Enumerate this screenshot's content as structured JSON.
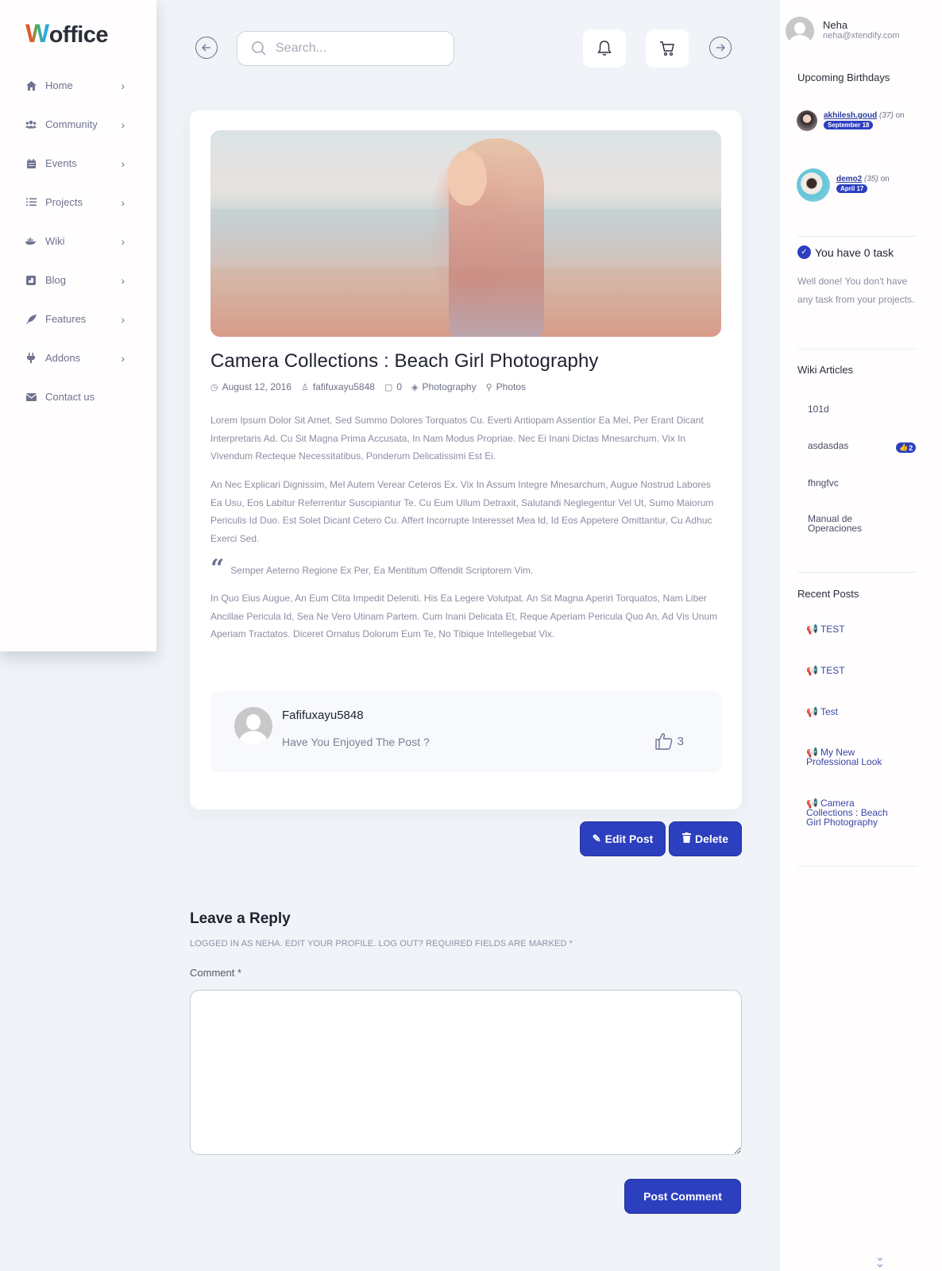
{
  "app": {
    "logo_w": "W",
    "logo_rest": "office"
  },
  "sidebar": {
    "items": [
      {
        "label": "Home",
        "icon": "home-icon",
        "has_submenu": true
      },
      {
        "label": "Community",
        "icon": "users-icon",
        "has_submenu": true
      },
      {
        "label": "Events",
        "icon": "calendar-icon",
        "has_submenu": true
      },
      {
        "label": "Projects",
        "icon": "tasks-icon",
        "has_submenu": true
      },
      {
        "label": "Wiki",
        "icon": "docker-icon",
        "has_submenu": true
      },
      {
        "label": "Blog",
        "icon": "blog-icon",
        "has_submenu": true
      },
      {
        "label": "Features",
        "icon": "feather-icon",
        "has_submenu": true
      },
      {
        "label": "Addons",
        "icon": "plug-icon",
        "has_submenu": true
      },
      {
        "label": "Contact us",
        "icon": "envelope-icon",
        "has_submenu": false
      }
    ],
    "chevron": "›"
  },
  "topbar": {
    "search_placeholder": "Search...",
    "back_icon": "←",
    "forward_icon": "→"
  },
  "post": {
    "title": "Camera Collections : Beach Girl Photography",
    "meta": {
      "date": "August 12, 2016",
      "author": "fafifuxayu5848",
      "comments": "0",
      "category": "Photography",
      "tag": "Photos"
    },
    "paragraphs": [
      "Lorem Ipsum Dolor Sit Amet, Sed Summo Dolores Torquatos Cu. Everti Antiopam Assentior Ea Mei, Per Erant Dicant Interpretaris Ad. Cu Sit Magna Prima Accusata, In Nam Modus Propriae. Nec Ei Inani Dictas Mnesarchum. Vix In Vivendum Recteque Necessitatibus, Ponderum Delicatissimi Est Ei.",
      "An Nec Explicari Dignissim, Mel Autem Verear Ceteros Ex. Vix In Assum Integre Mnesarchum, Augue Nostrud Labores Ea Usu, Eos Labitur Referrentur Suscipiantur Te. Cu Eum Ullum Detraxit, Salutandi Neglegentur Vel Ut, Sumo Maiorum Periculis Id Duo. Est Solet Dicant Cetero Cu. Affert Incorrupte Interesset Mea Id, Id Eos Appetere Omittantur, Cu Adhuc Exerci Sed.",
      "In Quo Eius Augue, An Eum Clita Impedit Deleniti. His Ea Legere Volutpat. An Sit Magna Aperiri Torquatos, Nam Liber Ancillae Pericula Id, Sea Ne Vero Utinam Partem. Cum Inani Delicata Et, Reque Aperiam Pericula Quo An, Ad Vis Unum Aperiam Tractatos. Diceret Ornatus Dolorum Eum Te, No Tibique Intellegebat Vix."
    ],
    "quote": "Semper Aeterno Regione Ex Per, Ea Mentitum Offendit Scriptorem Vim.",
    "author_box": {
      "name": "Fafifuxayu5848",
      "question": "Have You Enjoyed The Post ?",
      "likes": "3"
    }
  },
  "actions": {
    "edit_label": "Edit Post",
    "delete_label": "Delete"
  },
  "reply": {
    "title": "Leave a Reply",
    "meta": "LOGGED IN AS NEHA. EDIT YOUR PROFILE. LOG OUT? REQUIRED FIELDS ARE MARKED *",
    "comment_label": "Comment *",
    "comment_value": "",
    "submit_label": "Post Comment"
  },
  "right_sidebar": {
    "user": {
      "name": "Neha",
      "email": "neha@xtendify.com"
    },
    "birthdays_title": "Upcoming Birthdays",
    "birthdays": [
      {
        "name": "akhilesh.goud",
        "age": "(37)",
        "on": "on",
        "date": "September 18"
      },
      {
        "name": "demo2",
        "age": "(35)",
        "on": "on",
        "date": "April 17"
      }
    ],
    "tasks": {
      "title": "You have 0 task",
      "text": "Well done! You don't have any task from your projects."
    },
    "wiki_title": "Wiki Articles",
    "wiki": [
      {
        "label": "101d"
      },
      {
        "label": "asdasdas",
        "likes": "2"
      },
      {
        "label": "fhngfvc"
      },
      {
        "label": "Manual de Operaciones"
      }
    ],
    "recent_title": "Recent Posts",
    "recent": [
      {
        "label": "TEST"
      },
      {
        "label": "TEST"
      },
      {
        "label": "Test"
      },
      {
        "label": "My New Professional Look"
      },
      {
        "label": "Camera Collections : Beach Girl Photography"
      }
    ]
  },
  "colors": {
    "accent": "#2c3fbf",
    "background": "#f0f3f8",
    "muted_text": "#8b8ea1"
  }
}
